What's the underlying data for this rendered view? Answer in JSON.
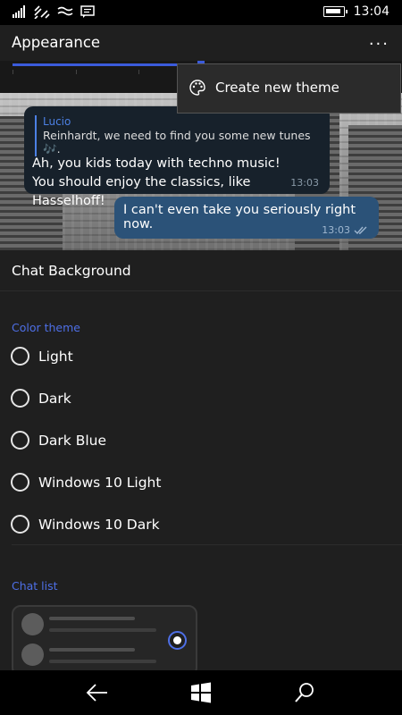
{
  "status_bar": {
    "time": "13:04"
  },
  "app_bar": {
    "title": "Appearance",
    "more_label": "..."
  },
  "popup_menu": {
    "item_label": "Create new theme",
    "icon": "palette-icon"
  },
  "preview": {
    "incoming": {
      "reply_author": "Lucio",
      "reply_text": "Reinhardt, we need to find you some new tunes 🎶.",
      "text": "Ah, you kids today with techno music! You should enjoy the classics, like Hasselhoff!",
      "time": "13:03"
    },
    "outgoing": {
      "text": "I can't even take you seriously right now.",
      "time": "13:03"
    }
  },
  "chat_background_label": "Chat Background",
  "color_theme": {
    "header": "Color theme",
    "options": [
      "Light",
      "Dark",
      "Dark Blue",
      "Windows 10 Light",
      "Windows 10 Dark"
    ]
  },
  "chat_list": {
    "header": "Chat list"
  },
  "colors": {
    "accent": "#4e6fe6",
    "bubble_in": "#17212b",
    "bubble_out": "#2b5278"
  },
  "nav": {
    "icons": [
      "back-icon",
      "windows-start-icon",
      "search-icon"
    ]
  }
}
